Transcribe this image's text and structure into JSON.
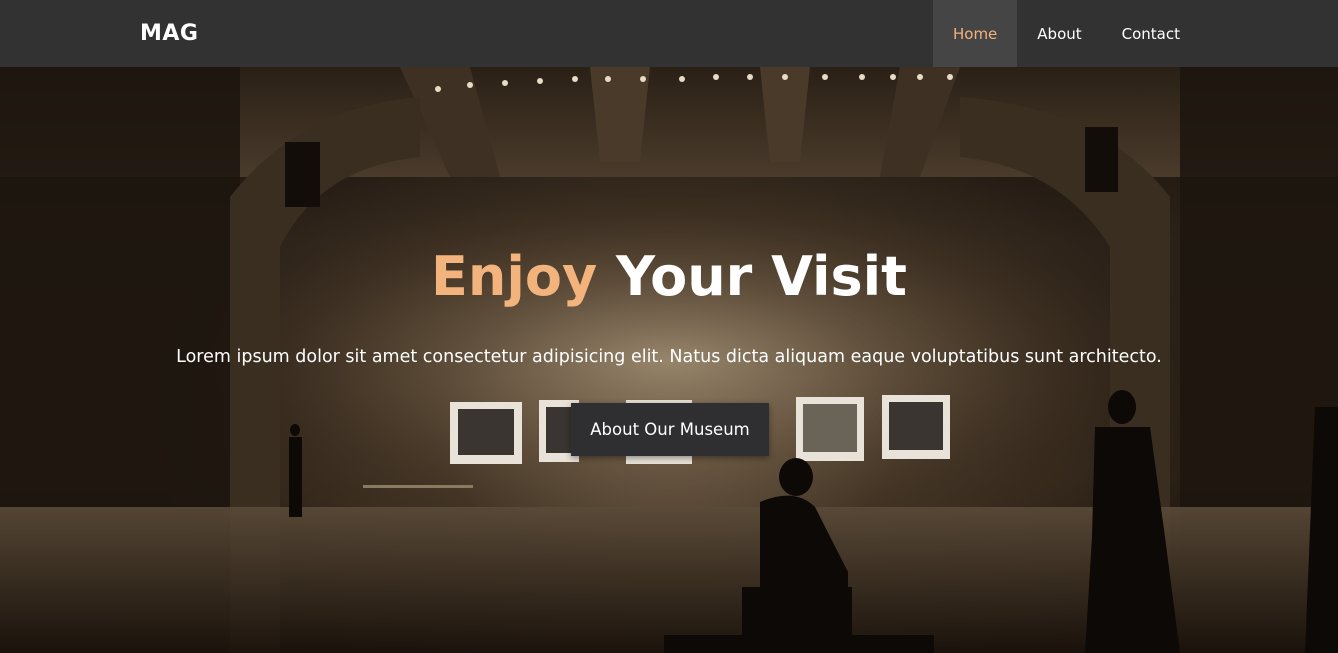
{
  "brand": {
    "name": "MAG"
  },
  "nav": {
    "items": [
      {
        "label": "Home",
        "active": true
      },
      {
        "label": "About",
        "active": false
      },
      {
        "label": "Contact",
        "active": false
      }
    ]
  },
  "hero": {
    "title_accent": "Enjoy",
    "title_rest": " Your Visit",
    "text": "Lorem ipsum dolor sit amet consectetur adipisicing elit. Natus dicta aliquam eaque voluptatibus sunt architecto.",
    "button_label": "About Our Museum"
  },
  "colors": {
    "navbar_bg": "#323232",
    "nav_active_bg": "#454545",
    "accent": "#f2b37c",
    "button_bg": "#2f2f31",
    "text": "#ffffff"
  }
}
